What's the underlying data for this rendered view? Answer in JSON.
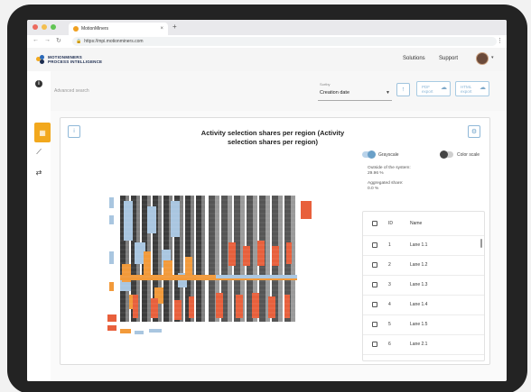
{
  "browser": {
    "tab_title": "MotionMiners",
    "url": "https://mpi.motionminers.com",
    "new_tab": "+"
  },
  "header": {
    "logo_line1": "MOTIONMINERS",
    "logo_line2": "PROCESS INTELLIGENCE",
    "nav": [
      "Solutions",
      "Support"
    ]
  },
  "filter": {
    "search_placeholder": "Advanced search",
    "sort_label": "Sortby",
    "sort_value": "Creation date",
    "pdf_export": "PDF export",
    "html_export": "HTML export"
  },
  "card": {
    "title": "Activity selection shares per region (Activity selection shares per region)",
    "grayscale_label": "Grayscale",
    "colorscale_label": "Color scale",
    "outside_label": "Outside of the system:",
    "outside_value": "29.96 %",
    "aggregated_label": "Aggregated share:",
    "aggregated_value": "0.0 %",
    "table_headers": {
      "id": "ID",
      "name": "Name"
    },
    "rows": [
      {
        "id": "1",
        "name": "Lane   1.1"
      },
      {
        "id": "2",
        "name": "Lane   1.2"
      },
      {
        "id": "3",
        "name": "Lane   1.3"
      },
      {
        "id": "4",
        "name": "Lane   1.4"
      },
      {
        "id": "5",
        "name": "Lane   1.5"
      },
      {
        "id": "6",
        "name": "Lane   2.1"
      }
    ]
  },
  "colors": {
    "accent_orange": "#f2a81d",
    "accent_blue": "#6aa0c8",
    "toggle_blue": "#8ab4d8",
    "heat_red": "#e8603c",
    "heat_orange": "#f29a3a",
    "heat_blue": "#a9c6e0"
  },
  "icons": {
    "info": "info-icon",
    "dashboard": "dashboard-icon",
    "trend": "trend-icon",
    "transfer": "transfer-icon",
    "upload": "upload-icon",
    "cloud": "cloud-upload-icon",
    "settings": "gear-icon"
  }
}
